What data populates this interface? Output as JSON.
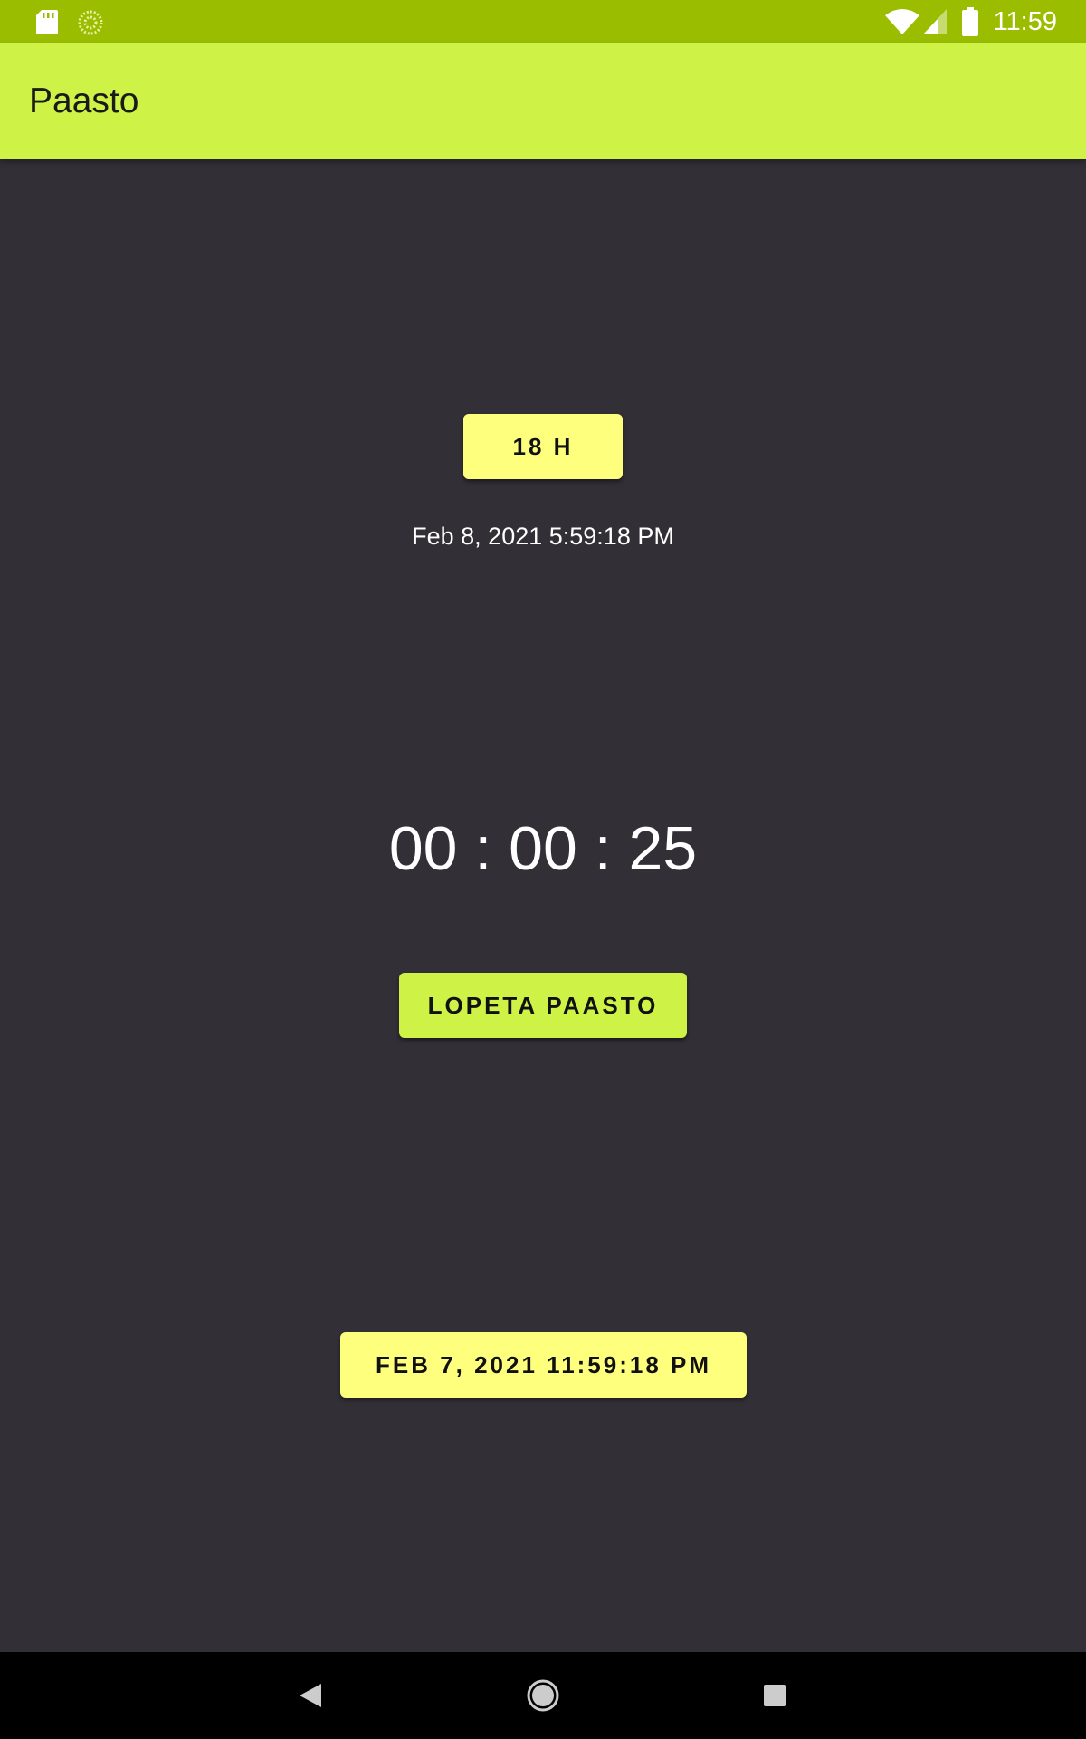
{
  "status_bar": {
    "time": "11:59",
    "icons": [
      "sd-card-icon",
      "sync-icon",
      "wifi-icon",
      "signal-icon",
      "battery-icon"
    ]
  },
  "app_bar": {
    "title": "Paasto"
  },
  "fast": {
    "duration_label": "18 H",
    "end_time": "Feb 8, 2021 5:59:18 PM",
    "elapsed": "00 : 00 : 25",
    "stop_label": "LOPETA PAASTO",
    "start_time_label": "FEB 7, 2021 11:59:18 PM"
  },
  "nav_bar": {
    "icons": [
      "back-icon",
      "home-icon",
      "recents-icon"
    ]
  },
  "colors": {
    "status_bar": "#9abd00",
    "app_bar": "#cff247",
    "background": "#332f37",
    "yellow_button": "#ffff7e",
    "green_button": "#cff247"
  }
}
